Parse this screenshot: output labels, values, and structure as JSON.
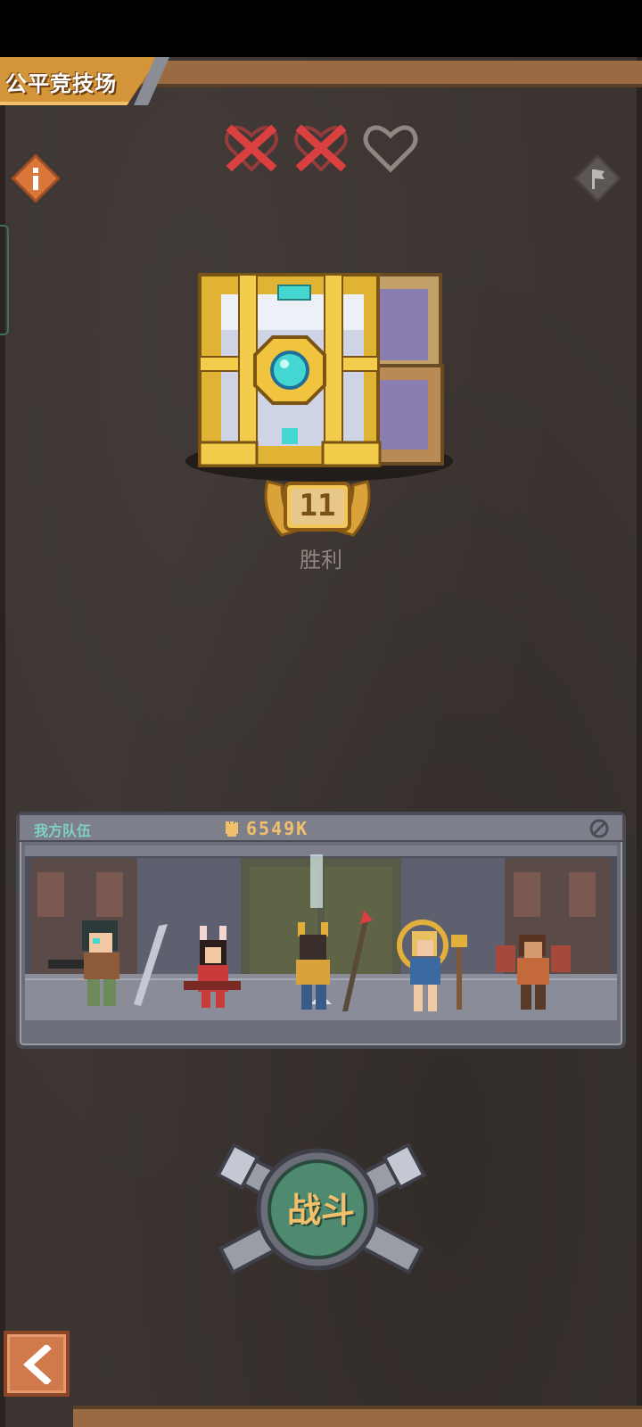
{
  "header": {
    "title": "公平竞技场"
  },
  "lives": {
    "lost": 2,
    "remaining": 1,
    "total": 3
  },
  "icons": {
    "info": "info-icon",
    "flag": "flag-icon",
    "power": "fist-icon",
    "settings": "gear-icon",
    "back": "chevron-left-icon"
  },
  "reward": {
    "wins": "11",
    "wins_label": "胜利"
  },
  "team": {
    "label": "我方队伍",
    "power": "6549K",
    "hero_count": 5
  },
  "actions": {
    "battle_label": "战斗"
  },
  "colors": {
    "accent": "#d49438",
    "background": "#3b3431",
    "lost_life": "#d9403f",
    "battle_button": "#4d8a6f",
    "back_button": "#d07a4c"
  }
}
